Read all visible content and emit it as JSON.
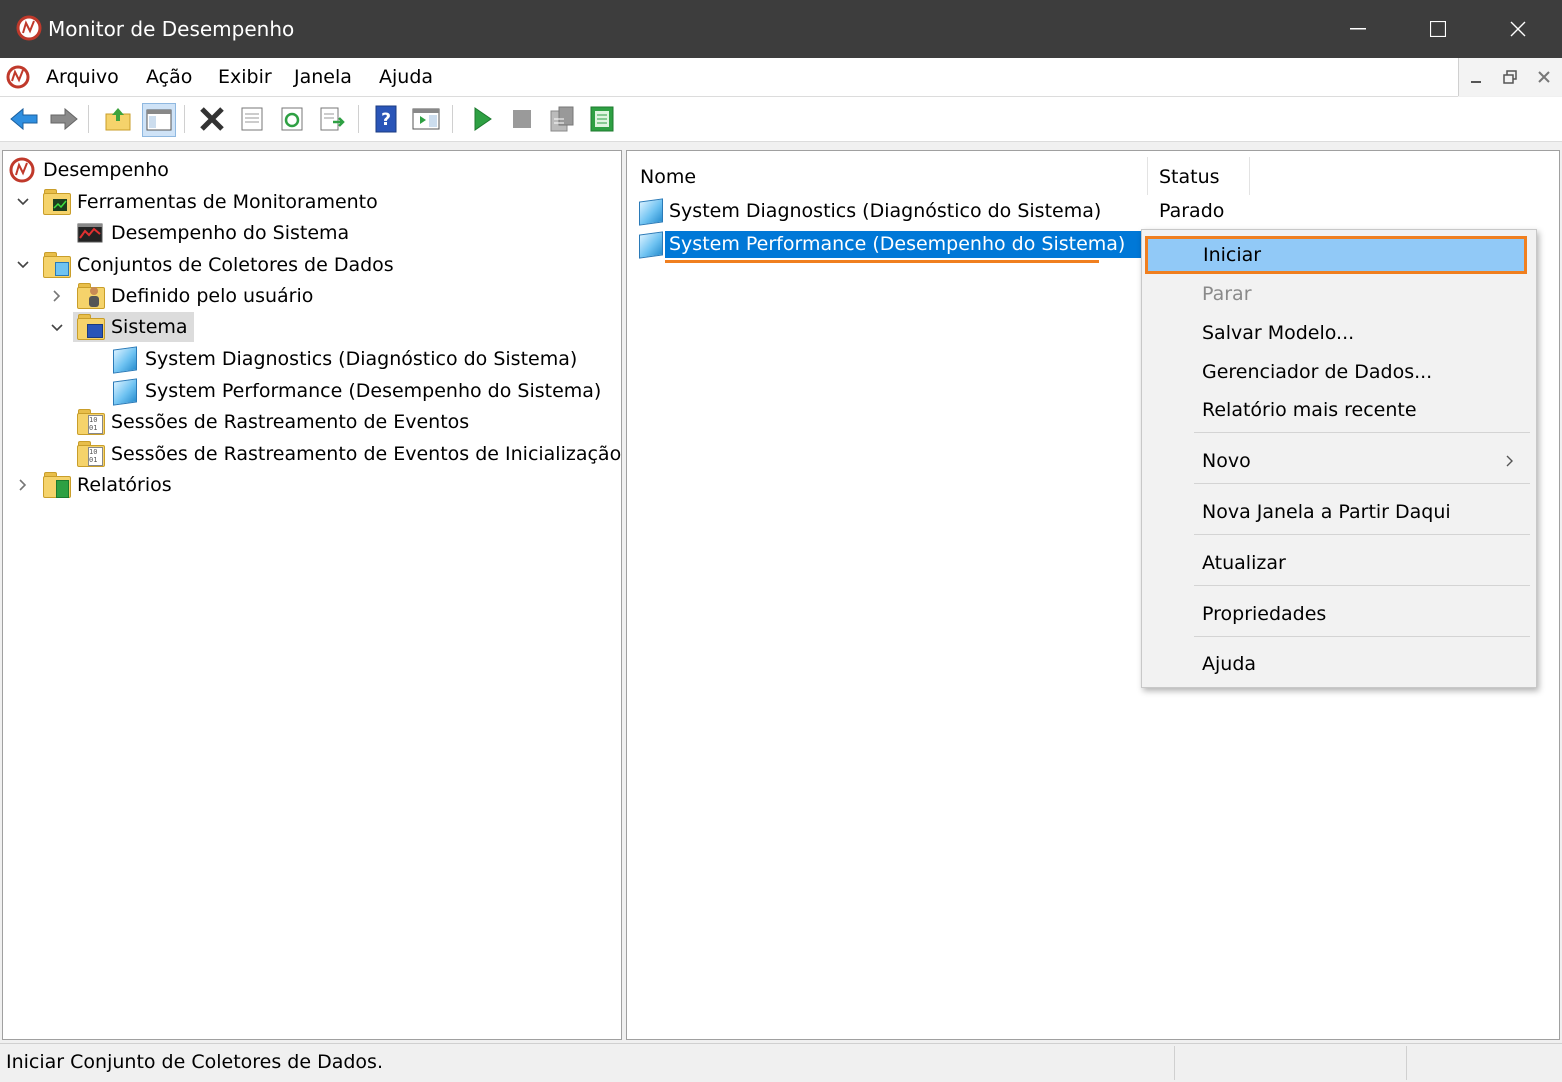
{
  "window": {
    "title": "Monitor de Desempenho"
  },
  "menubar": {
    "items": [
      "Arquivo",
      "Ação",
      "Exibir",
      "Janela",
      "Ajuda"
    ]
  },
  "toolbar": {
    "buttons": [
      "back-icon",
      "forward-icon",
      "up-folder-icon",
      "show-hide-tree-icon",
      "delete-icon",
      "properties-icon",
      "refresh-icon",
      "export-list-icon",
      "help-icon",
      "show-hide-action-pane-icon",
      "start-icon",
      "stop-icon",
      "latest-report-icon",
      "data-manager-icon"
    ]
  },
  "tree": {
    "root": "Desempenho",
    "monitoring_tools": "Ferramentas de Monitoramento",
    "system_performance_node": "Desempenho do Sistema",
    "data_collector_sets": "Conjuntos de Coletores de Dados",
    "user_defined": "Definido pelo usuário",
    "system": "Sistema",
    "system_diagnostics": "System Diagnostics (Diagnóstico do Sistema)",
    "system_performance": "System Performance (Desempenho do Sistema)",
    "event_trace_sessions": "Sessões de Rastreamento de Eventos",
    "startup_event_trace_sessions": "Sessões de Rastreamento de Eventos de Inicialização",
    "reports": "Relatórios"
  },
  "list": {
    "columns": {
      "name": "Nome",
      "status": "Status"
    },
    "rows": [
      {
        "name": "System Diagnostics (Diagnóstico do Sistema)",
        "status": "Parado"
      },
      {
        "name": "System Performance (Desempenho do Sistema)",
        "status": ""
      }
    ]
  },
  "context_menu": {
    "start": "Iniciar",
    "stop": "Parar",
    "save_template": "Salvar Modelo...",
    "data_manager": "Gerenciador de Dados...",
    "latest_report": "Relatório mais recente",
    "new": "Novo",
    "new_window": "Nova Janela a Partir Daqui",
    "refresh": "Atualizar",
    "properties": "Propriedades",
    "help": "Ajuda"
  },
  "statusbar": {
    "text": "Iniciar Conjunto de Coletores de Dados."
  },
  "colors": {
    "selection": "#0078d7",
    "menu_highlight": "#91c9f7",
    "callout": "#f07f1f"
  }
}
